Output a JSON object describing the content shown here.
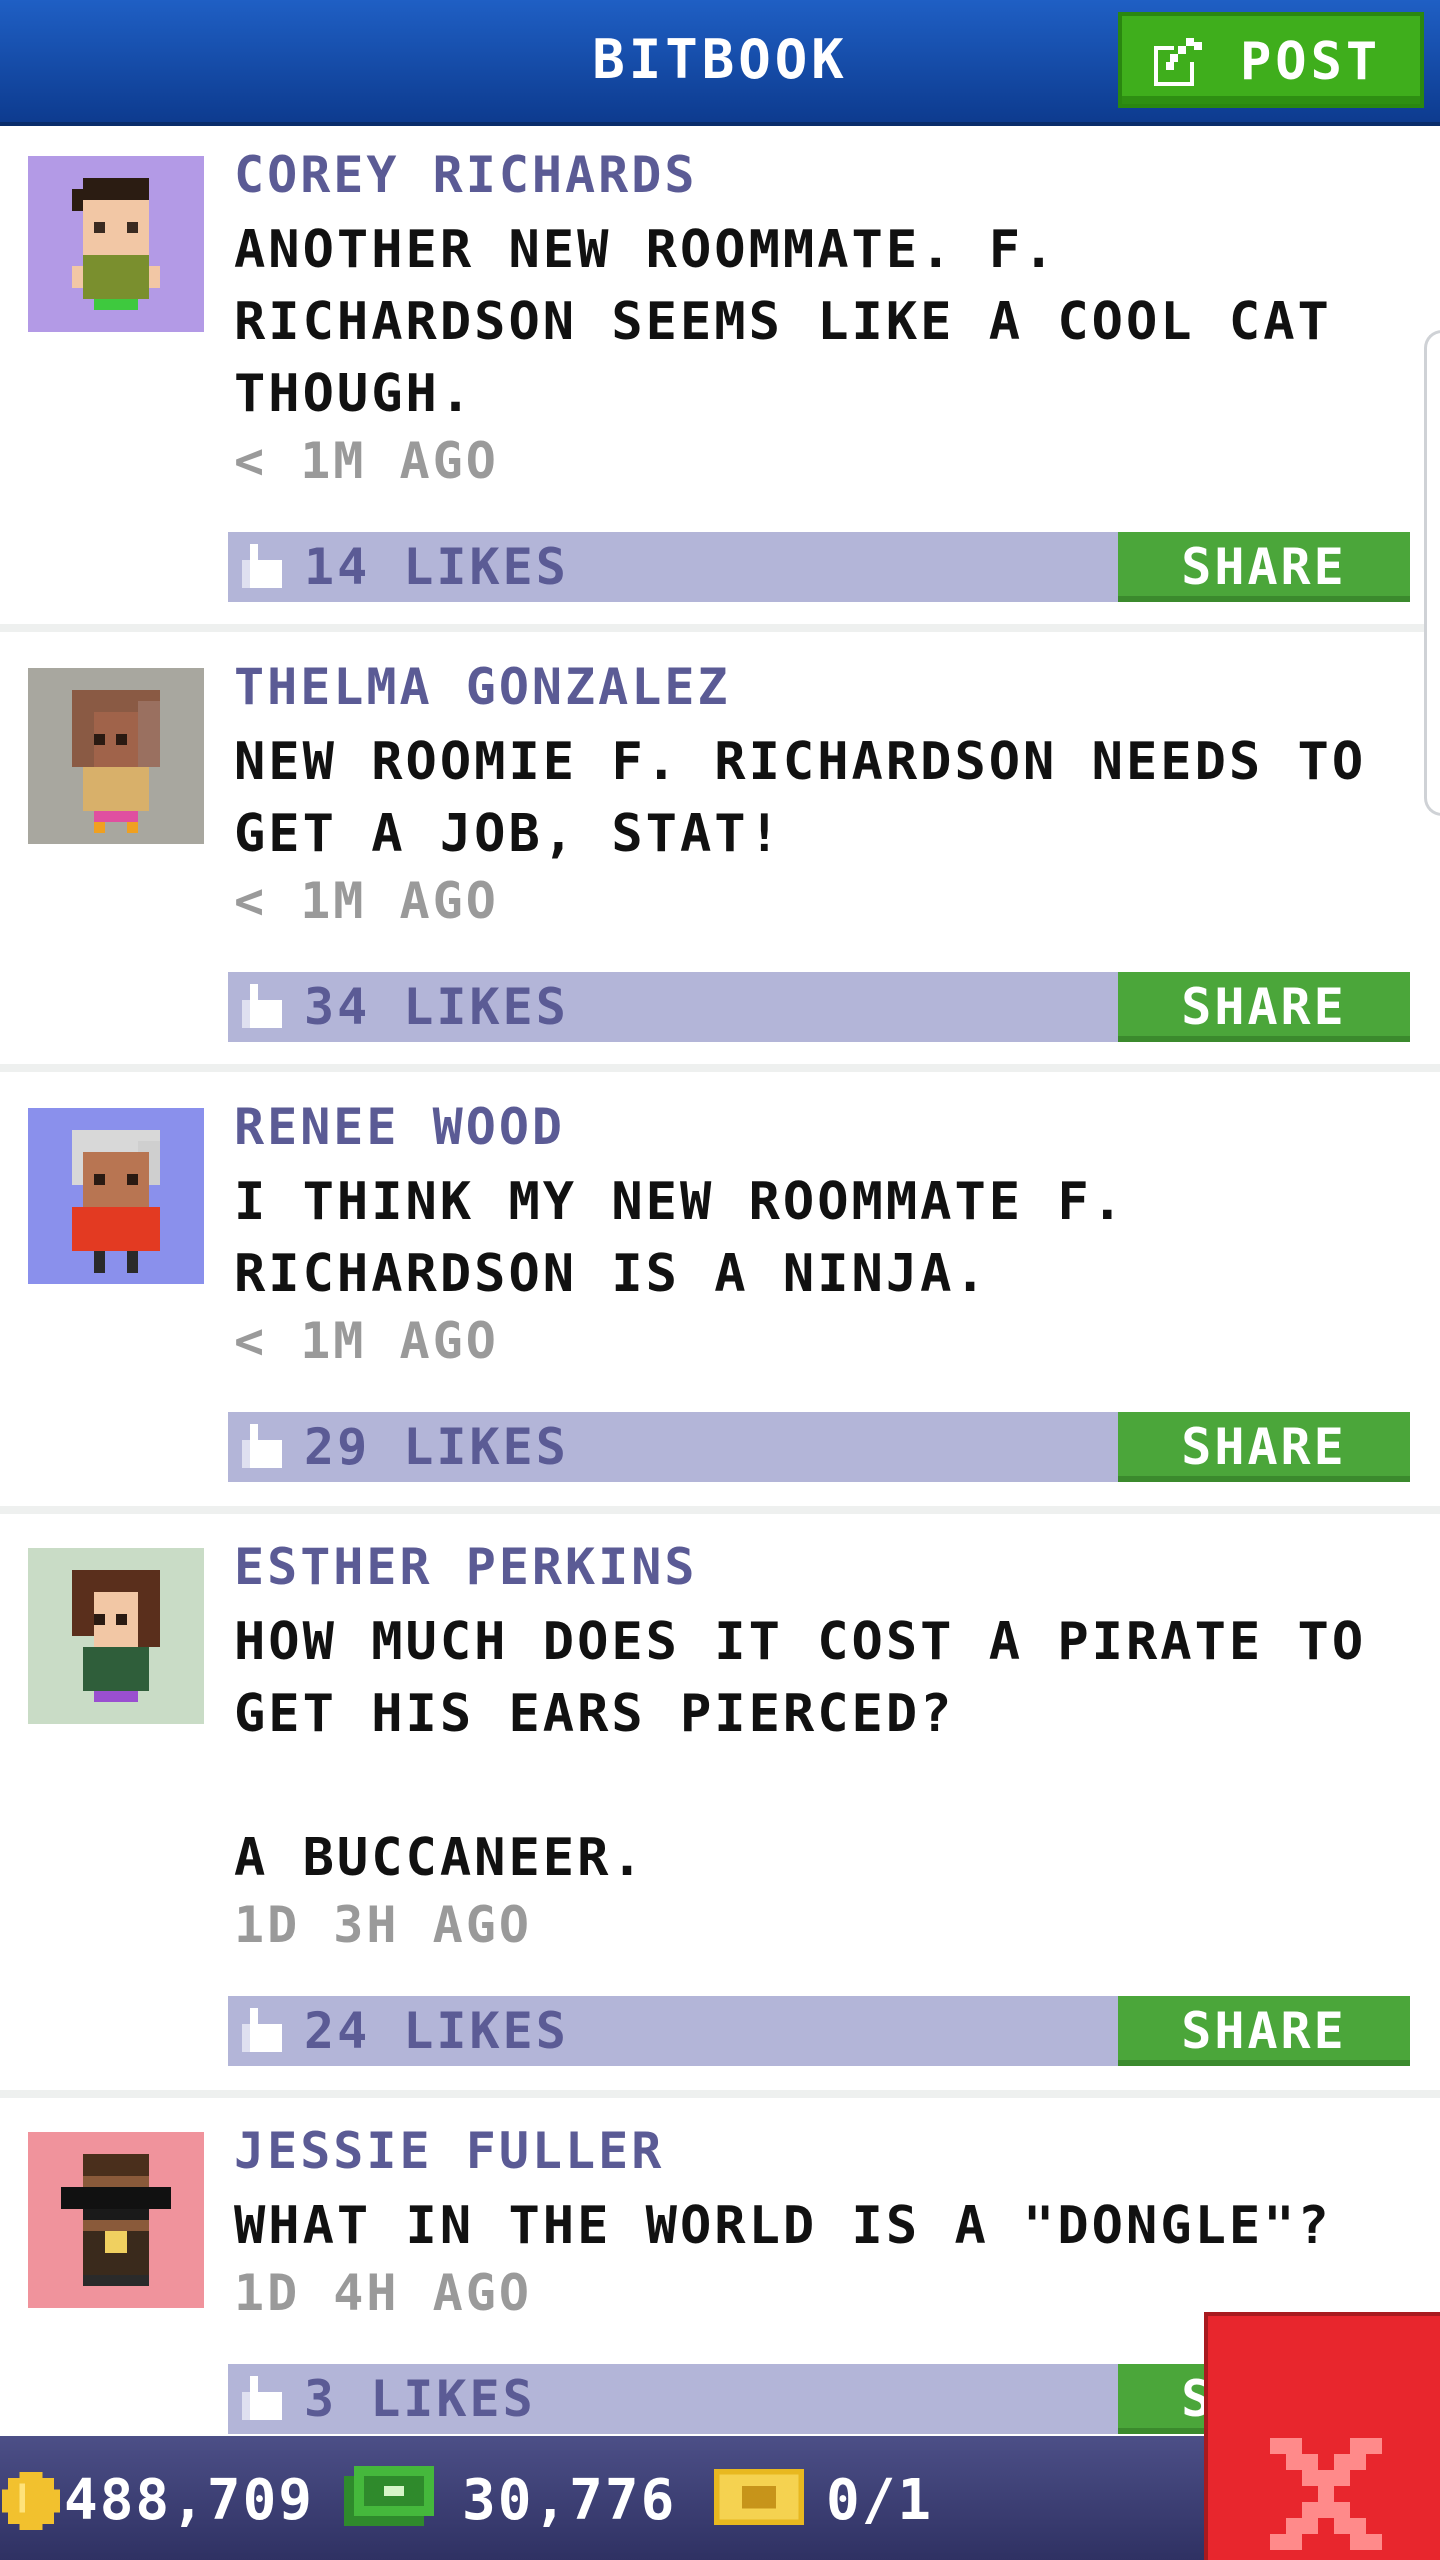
{
  "header": {
    "title": "BITBOOK",
    "post_label": "POST",
    "post_icon": "compose-icon",
    "bg_color": "#1f5fc4",
    "post_color": "#3fae1c"
  },
  "posts": [
    {
      "author": "COREY RICHARDS",
      "message": "ANOTHER NEW ROOMMATE. F.\nRICHARDSON SEEMS LIKE A COOL CAT\nTHOUGH.",
      "time": "< 1M AGO",
      "likes": "14 LIKES",
      "share": "SHARE",
      "avatar_bg": "#b39ae6"
    },
    {
      "author": "THELMA GONZALEZ",
      "message": "NEW ROOMIE F. RICHARDSON NEEDS TO\nGET A JOB, STAT!",
      "time": "< 1M AGO",
      "likes": "34 LIKES",
      "share": "SHARE",
      "avatar_bg": "#a8a79f"
    },
    {
      "author": "RENEE WOOD",
      "message": "I THINK MY NEW ROOMMATE F.\nRICHARDSON IS A NINJA.",
      "time": "< 1M AGO",
      "likes": "29 LIKES",
      "share": "SHARE",
      "avatar_bg": "#8a90ec"
    },
    {
      "author": "ESTHER PERKINS",
      "message": "HOW MUCH DOES IT COST A PIRATE TO\nGET HIS EARS PIERCED?\n\nA BUCCANEER.",
      "time": "1D 3H AGO",
      "likes": "24 LIKES",
      "share": "SHARE",
      "avatar_bg": "#c9dcc6"
    },
    {
      "author": "JESSIE FULLER",
      "message": "WHAT IN THE WORLD IS A \"DONGLE\"?",
      "time": "1D 4H AGO",
      "likes": "3 LIKES",
      "share": "SHARE",
      "avatar_bg": "#f0939c"
    }
  ],
  "status": {
    "coins": "488,709",
    "cash": "30,776",
    "tickets": "0/1",
    "coin_icon": "coin-icon",
    "cash_icon": "cash-icon",
    "ticket_icon": "golden-ticket-icon"
  },
  "close_icon": "close-icon",
  "colors": {
    "likes_bar": "#b3b5d8",
    "share": "#4ba63a",
    "name": "#5b5b95",
    "close": "#e8262d"
  }
}
